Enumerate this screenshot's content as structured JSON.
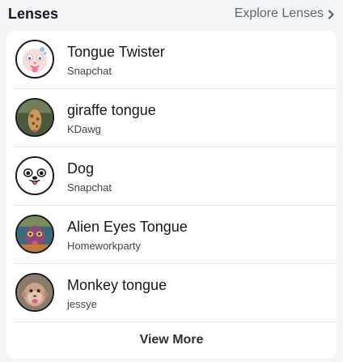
{
  "header": {
    "title": "Lenses",
    "explore_label": "Explore Lenses"
  },
  "lenses": [
    {
      "name": "Tongue Twister",
      "creator": "Snapchat",
      "icon": "tongue-twister-avatar"
    },
    {
      "name": "giraffe tongue",
      "creator": "KDawg",
      "icon": "giraffe-photo-avatar"
    },
    {
      "name": "Dog",
      "creator": "Snapchat",
      "icon": "dog-face-avatar"
    },
    {
      "name": "Alien Eyes Tongue",
      "creator": "Homeworkparty",
      "icon": "alien-photo-avatar"
    },
    {
      "name": "Monkey tongue",
      "creator": "jessye",
      "icon": "monkey-photo-avatar"
    }
  ],
  "footer": {
    "view_more_label": "View More"
  }
}
